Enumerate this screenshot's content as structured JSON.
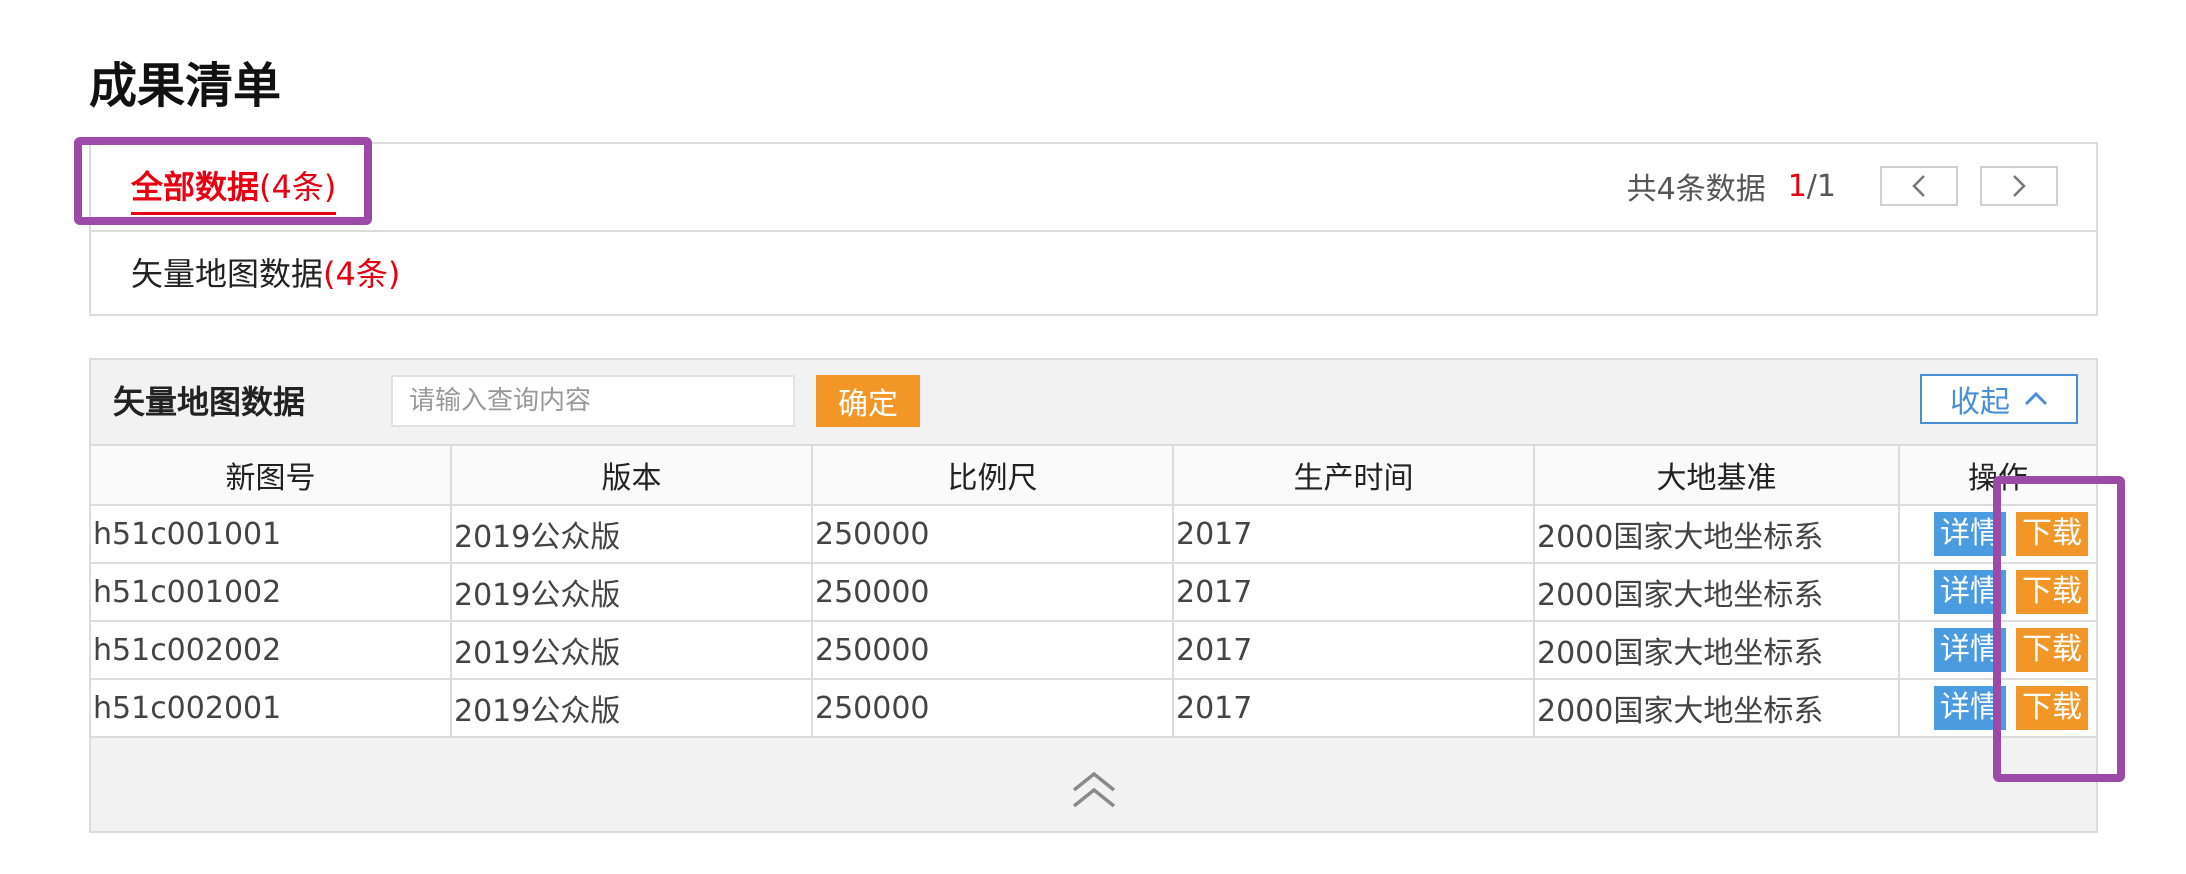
{
  "page": {
    "title": "成果清单"
  },
  "categories": {
    "all": {
      "label": "全部数据",
      "count": "(4条)"
    },
    "vector": {
      "label": "矢量地图数据",
      "count": "(4条)"
    }
  },
  "pager": {
    "total_text": "共4条数据",
    "current": "1",
    "total_pages": "/1"
  },
  "data_panel": {
    "title": "矢量地图数据",
    "search_placeholder": "请输入查询内容",
    "confirm_label": "确定",
    "collapse_label": "收起"
  },
  "table": {
    "headers": [
      "新图号",
      "版本",
      "比例尺",
      "生产时间",
      "大地基准",
      "操作"
    ],
    "rows": [
      [
        "h51c001001",
        "2019公众版",
        "250000",
        "2017",
        "2000国家大地坐标系"
      ],
      [
        "h51c001002",
        "2019公众版",
        "250000",
        "2017",
        "2000国家大地坐标系"
      ],
      [
        "h51c002002",
        "2019公众版",
        "250000",
        "2017",
        "2000国家大地坐标系"
      ],
      [
        "h51c002001",
        "2019公众版",
        "250000",
        "2017",
        "2000国家大地坐标系"
      ]
    ],
    "actions": {
      "detail": "详情",
      "download": "下载"
    }
  },
  "colors": {
    "accent_red": "#e60012",
    "orange": "#f39628",
    "blue": "#4a9be0",
    "highlight": "#9b4aa8"
  },
  "icons": {
    "prev": "chevron-left-icon",
    "next": "chevron-right-icon",
    "collapse": "chevron-up-icon",
    "fold": "double-chevron-up-icon"
  }
}
